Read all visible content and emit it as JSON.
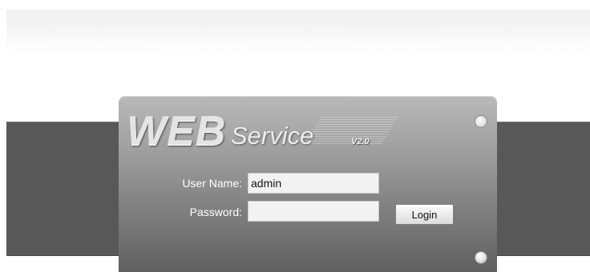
{
  "logo": {
    "web": "WEB",
    "service": "Service",
    "version": "V2.0"
  },
  "login": {
    "username_label": "User Name:",
    "username_value": "admin",
    "password_label": "Password:",
    "password_value": "",
    "button_label": "Login"
  }
}
